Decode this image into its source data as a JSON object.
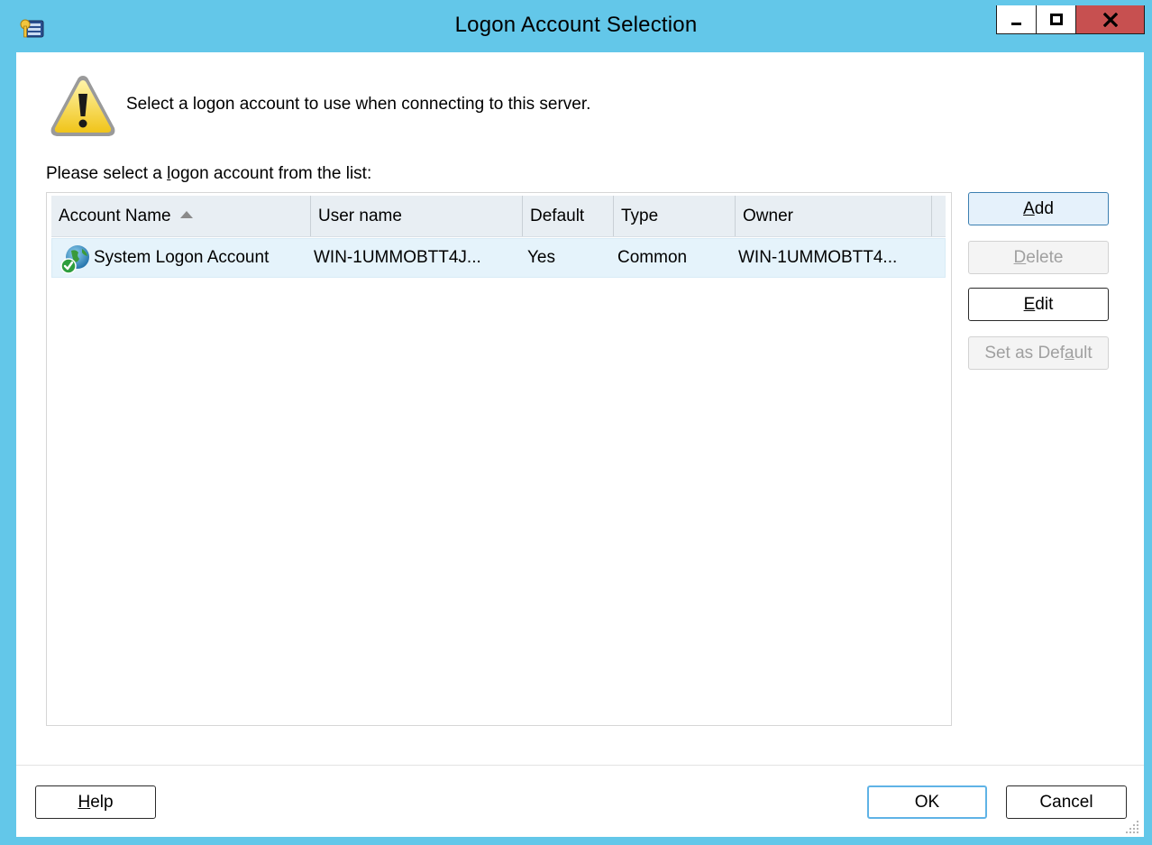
{
  "window": {
    "title": "Logon Account Selection",
    "controls": {
      "minimize": "minimize",
      "maximize": "maximize",
      "close": "close"
    }
  },
  "header": {
    "message": "Select a logon account to use when connecting to this server.",
    "icon": "warning-icon"
  },
  "list": {
    "label_pre": "Please select a ",
    "label_hot": "l",
    "label_post": "ogon account from the list:",
    "columns": [
      {
        "label": "Account Name",
        "sorted": "ascending"
      },
      {
        "label": "User name"
      },
      {
        "label": "Default"
      },
      {
        "label": "Type"
      },
      {
        "label": "Owner"
      }
    ],
    "rows": [
      {
        "account_name": "System Logon Account",
        "user_name": "WIN-1UMMOBTT4J...",
        "default": "Yes",
        "type": "Common",
        "owner": "WIN-1UMMOBTT4...",
        "icon": "globe-check-icon",
        "selected": true
      }
    ]
  },
  "side_buttons": {
    "add": {
      "hot": "A",
      "rest": "dd",
      "enabled": true
    },
    "delete": {
      "hot": "D",
      "rest": "elete",
      "enabled": false
    },
    "edit": {
      "hot": "E",
      "rest": "dit",
      "enabled": true
    },
    "set_default": {
      "pre": "Set as Def",
      "hot": "a",
      "post": "ult",
      "enabled": false
    }
  },
  "bottom_buttons": {
    "help": {
      "hot": "H",
      "rest": "elp"
    },
    "ok": "OK",
    "cancel": "Cancel"
  },
  "colors": {
    "frame": "#63c7e9",
    "close_button": "#c75050",
    "selected_row": "#e5f3fb",
    "header_bg": "#e8eef3"
  }
}
